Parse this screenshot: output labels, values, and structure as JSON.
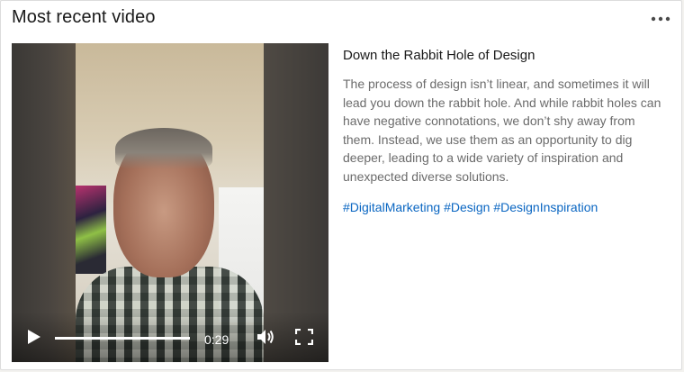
{
  "card": {
    "title": "Most recent video",
    "more_icon": "more-horizontal-icon"
  },
  "video": {
    "time": "0:29",
    "progress": 1.0,
    "controls": {
      "play_icon": "play-icon",
      "volume_icon": "volume-icon",
      "fullscreen_icon": "fullscreen-icon"
    }
  },
  "post": {
    "title": "Down the Rabbit Hole of Design",
    "description": "The process of design isn’t linear, and sometimes it will lead you down the rabbit hole. And while rabbit holes can have negative connotations, we don’t shy away from them. Instead, we use them as an opportunity to dig deeper, leading to a wide variety of inspiration and unexpected diverse solutions.",
    "hashtags": [
      "#DigitalMarketing",
      "#Design",
      "#DesignInspiration"
    ]
  },
  "colors": {
    "link": "#0a66c2",
    "title_text": "#191919",
    "body_text": "#6b6b6b"
  }
}
